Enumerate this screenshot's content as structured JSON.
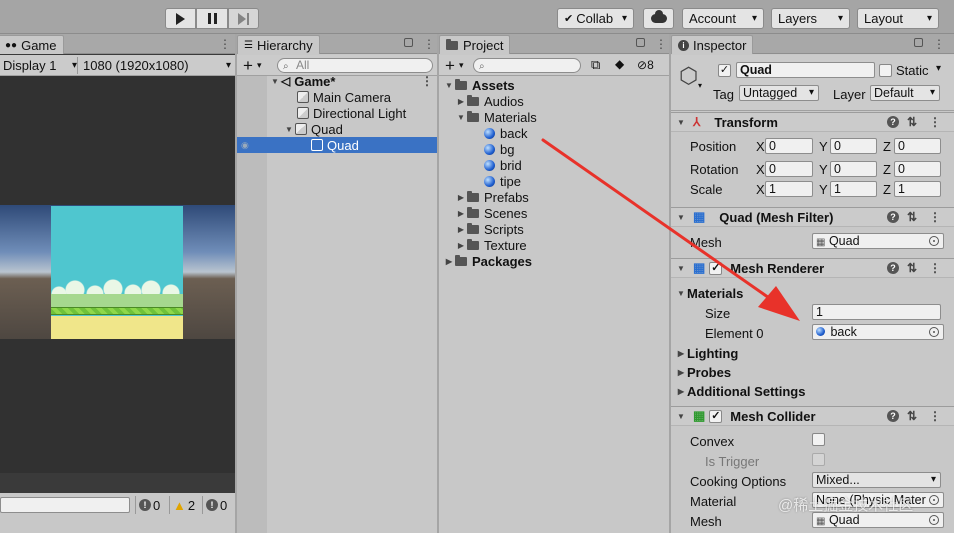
{
  "topbar": {
    "collab_label": "Collab",
    "account_label": "Account",
    "layers_label": "Layers",
    "layout_label": "Layout"
  },
  "game": {
    "tab_label": "Game",
    "display_label": "Display 1",
    "resolution_label": "1080 (1920x1080)",
    "console_counts": {
      "info": "0",
      "warn": "2",
      "error": "0"
    }
  },
  "hierarchy": {
    "tab_label": "Hierarchy",
    "search_placeholder": "All",
    "items": [
      {
        "label": "Game*"
      },
      {
        "label": "Main Camera"
      },
      {
        "label": "Directional Light"
      },
      {
        "label": "Quad"
      },
      {
        "label": "Quad"
      }
    ]
  },
  "project": {
    "tab_label": "Project",
    "hidden_count": "8",
    "tree": [
      {
        "label": "Assets"
      },
      {
        "label": "Audios"
      },
      {
        "label": "Materials"
      },
      {
        "label": "back"
      },
      {
        "label": "bg"
      },
      {
        "label": "brid"
      },
      {
        "label": "tipe"
      },
      {
        "label": "Prefabs"
      },
      {
        "label": "Scenes"
      },
      {
        "label": "Scripts"
      },
      {
        "label": "Texture"
      },
      {
        "label": "Packages"
      }
    ]
  },
  "inspector": {
    "tab_label": "Inspector",
    "object_name": "Quad",
    "static_label": "Static",
    "tag_label": "Tag",
    "tag_value": "Untagged",
    "layer_label": "Layer",
    "layer_value": "Default",
    "transform": {
      "title": "Transform",
      "position_label": "Position",
      "rotation_label": "Rotation",
      "scale_label": "Scale",
      "x": "X",
      "y": "Y",
      "z": "Z",
      "position": [
        "0",
        "0",
        "0"
      ],
      "rotation": [
        "0",
        "0",
        "0"
      ],
      "scale": [
        "1",
        "1",
        "1"
      ]
    },
    "mesh_filter": {
      "title": "Quad (Mesh Filter)",
      "mesh_label": "Mesh",
      "mesh_value": "Quad"
    },
    "mesh_renderer": {
      "title": "Mesh Renderer",
      "materials_label": "Materials",
      "size_label": "Size",
      "size_value": "1",
      "element0_label": "Element 0",
      "element0_value": "back",
      "lighting_label": "Lighting",
      "probes_label": "Probes",
      "additional_label": "Additional Settings"
    },
    "mesh_collider": {
      "title": "Mesh Collider",
      "convex_label": "Convex",
      "is_trigger_label": "Is Trigger",
      "cooking_label": "Cooking Options",
      "cooking_value": "Mixed...",
      "material_label": "Material",
      "material_value": "None (Physic Mater",
      "mesh_label": "Mesh",
      "mesh_value": "Quad"
    }
  },
  "watermark": "@稀土掘金技术社区",
  "colors": {
    "selection": "#3a72c4",
    "sky": "#4fc6cf",
    "ground": "#f0e68a",
    "arrow": "#e8322a"
  }
}
